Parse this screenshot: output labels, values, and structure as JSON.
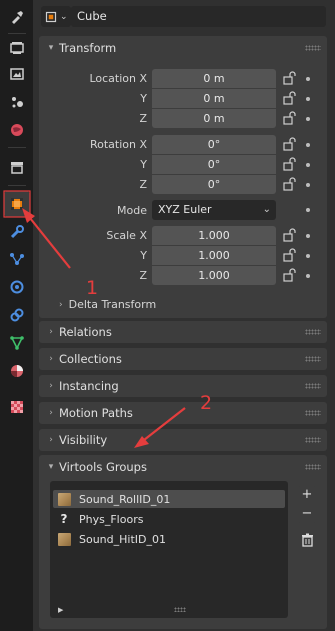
{
  "header": {
    "object_name": "Cube"
  },
  "sidebar": {
    "tabs": [
      "tool-icon",
      "render-icon",
      "output-icon",
      "view-layer-icon",
      "scene-icon",
      "world-icon",
      "collection-icon",
      "object-icon",
      "modifier-icon",
      "particles-icon",
      "physics-icon",
      "constraints-icon",
      "object-data-icon",
      "material-icon",
      "texture-icon"
    ],
    "active_tab": "object-icon"
  },
  "transform": {
    "title": "Transform",
    "location": {
      "label_x": "Location X",
      "label_y": "Y",
      "label_z": "Z",
      "x": "0 m",
      "y": "0 m",
      "z": "0 m"
    },
    "rotation": {
      "label_x": "Rotation X",
      "label_y": "Y",
      "label_z": "Z",
      "x": "0°",
      "y": "0°",
      "z": "0°"
    },
    "mode": {
      "label": "Mode",
      "value": "XYZ Euler"
    },
    "scale": {
      "label_x": "Scale X",
      "label_y": "Y",
      "label_z": "Z",
      "x": "1.000",
      "y": "1.000",
      "z": "1.000"
    },
    "delta": "Delta Transform"
  },
  "panels": {
    "relations": "Relations",
    "collections": "Collections",
    "instancing": "Instancing",
    "motion_paths": "Motion Paths",
    "visibility": "Visibility"
  },
  "virtools": {
    "title": "Virtools Groups",
    "items": [
      {
        "label": "Sound_RollID_01",
        "icon": "wood-texture-icon"
      },
      {
        "label": "Phys_Floors",
        "icon": "question-icon"
      },
      {
        "label": "Sound_HitID_01",
        "icon": "wood-texture-icon"
      }
    ],
    "add": "+",
    "remove": "−"
  },
  "annotations": {
    "label_1": "1",
    "label_2": "2",
    "color": "#e43d3d"
  },
  "colors": {
    "accent": "#e87d0d",
    "annotation": "#e43d3d"
  }
}
